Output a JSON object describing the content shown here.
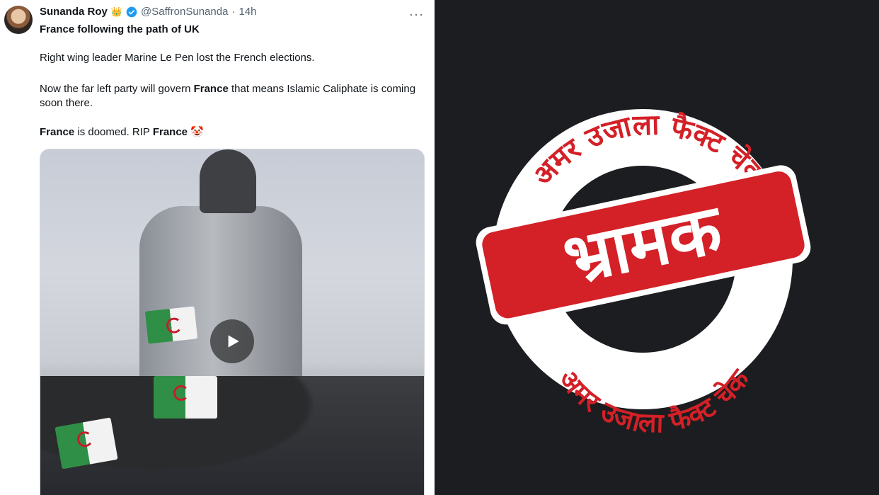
{
  "tweet": {
    "author_name": "Sunanda Roy",
    "crown_emoji": "👑",
    "handle": "@SaffronSunanda",
    "separator": "·",
    "time": "14h",
    "more_label": "···",
    "headline": "France following the path of UK",
    "paragraph1": "Right wing leader Marine Le Pen lost the French elections.",
    "p2_part1": "Now the far left party will govern ",
    "p2_bold": "France",
    "p2_part2": " that means Islamic Caliphate is coming soon there.",
    "p3_bold1": "France",
    "p3_part": " is doomed. RIP ",
    "p3_bold2": "France",
    "p3_emoji": "🤡"
  },
  "stamp": {
    "top_arc_text": "अमर उजाला फैक्ट चेक",
    "bottom_arc_text": "अमर उजाला फैक्ट चेक",
    "verdict": "भ्रामक"
  },
  "colors": {
    "stamp_red": "#d42027",
    "panel_bg": "#1c1d20",
    "verified_blue": "#1d9bf0"
  },
  "icons": [
    "verified-badge-icon",
    "more-icon",
    "play-icon"
  ]
}
